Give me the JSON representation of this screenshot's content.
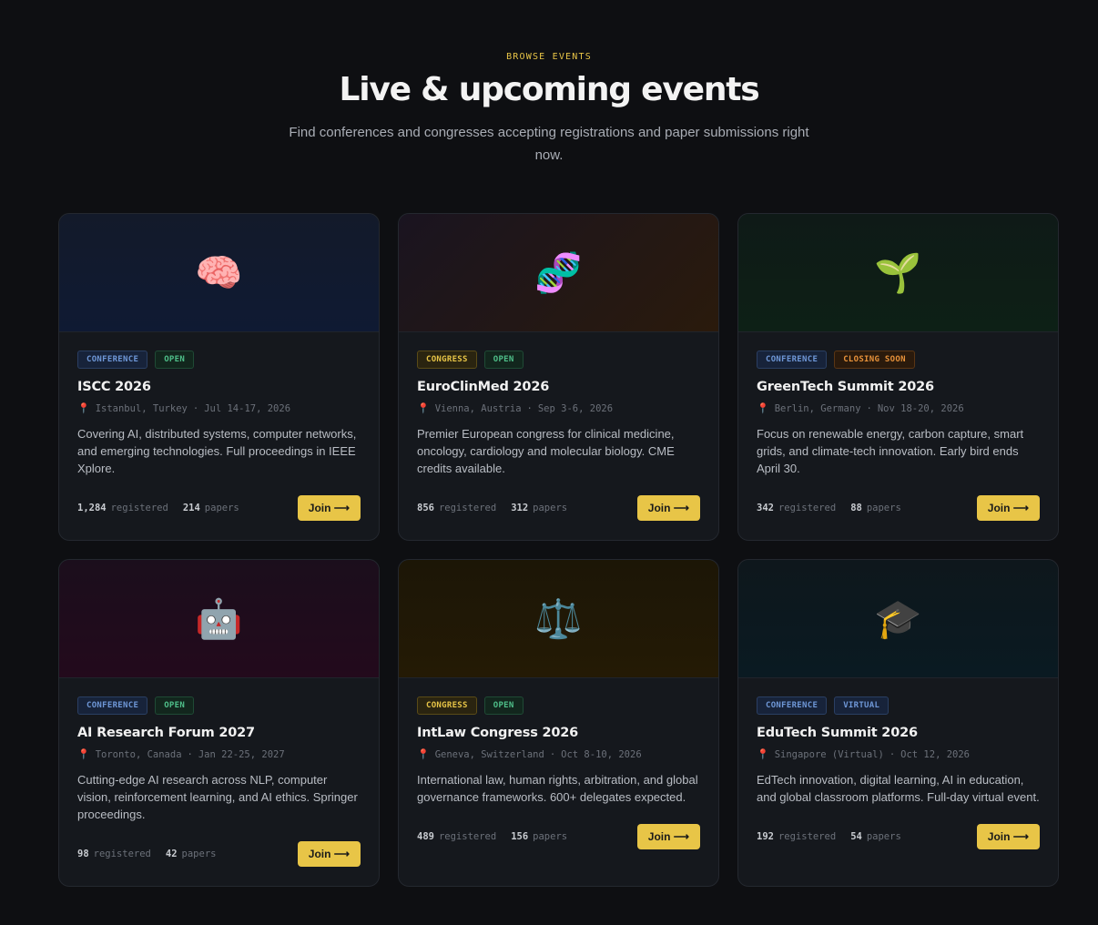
{
  "hero": {
    "eyebrow": "BROWSE EVENTS",
    "title": "Live & upcoming events",
    "subtitle": "Find conferences and congresses accepting registrations and paper submissions right now."
  },
  "events": [
    {
      "icon": "🧠",
      "icon_name": "brain-icon",
      "theme": "b-blue",
      "type": "CONFERENCE",
      "status": "OPEN",
      "title": "ISCC 2026",
      "location": "Istanbul, Turkey",
      "dates": "Jul 14-17, 2026",
      "description": "Covering AI, distributed systems, computer networks, and emerging technologies. Full proceedings in IEEE Xplore.",
      "registered": "1,284",
      "papers": "214",
      "registered_label": "registered",
      "papers_label": "papers",
      "join": "Join ⟶"
    },
    {
      "icon": "🧬",
      "icon_name": "dna-icon",
      "theme": "b-brown",
      "type": "CONGRESS",
      "status": "OPEN",
      "title": "EuroClinMed 2026",
      "location": "Vienna, Austria",
      "dates": "Sep 3-6, 2026",
      "description": "Premier European congress for clinical medicine, oncology, cardiology and molecular biology. CME credits available.",
      "registered": "856",
      "papers": "312",
      "registered_label": "registered",
      "papers_label": "papers",
      "join": "Join ⟶"
    },
    {
      "icon": "🌱",
      "icon_name": "seedling-icon",
      "theme": "b-green",
      "type": "CONFERENCE",
      "status": "CLOSING SOON",
      "title": "GreenTech Summit 2026",
      "location": "Berlin, Germany",
      "dates": "Nov 18-20, 2026",
      "description": "Focus on renewable energy, carbon capture, smart grids, and climate-tech innovation. Early bird ends April 30.",
      "registered": "342",
      "papers": "88",
      "registered_label": "registered",
      "papers_label": "papers",
      "join": "Join ⟶"
    },
    {
      "icon": "🤖",
      "icon_name": "robot-icon",
      "theme": "b-plum",
      "type": "CONFERENCE",
      "status": "OPEN",
      "title": "AI Research Forum 2027",
      "location": "Toronto, Canada",
      "dates": "Jan 22-25, 2027",
      "description": "Cutting-edge AI research across NLP, computer vision, reinforcement learning, and AI ethics. Springer proceedings.",
      "registered": "98",
      "papers": "42",
      "registered_label": "registered",
      "papers_label": "papers",
      "join": "Join ⟶"
    },
    {
      "icon": "⚖️",
      "icon_name": "scales-icon",
      "theme": "b-amber",
      "type": "CONGRESS",
      "status": "OPEN",
      "title": "IntLaw Congress 2026",
      "location": "Geneva, Switzerland",
      "dates": "Oct 8-10, 2026",
      "description": "International law, human rights, arbitration, and global governance frameworks. 600+ delegates expected.",
      "registered": "489",
      "papers": "156",
      "registered_label": "registered",
      "papers_label": "papers",
      "join": "Join ⟶"
    },
    {
      "icon": "🎓",
      "icon_name": "graduation-cap-icon",
      "theme": "b-teal",
      "type": "CONFERENCE",
      "status": "VIRTUAL",
      "title": "EduTech Summit 2026",
      "location": "Singapore (Virtual)",
      "dates": "Oct 12, 2026",
      "description": "EdTech innovation, digital learning, AI in education, and global classroom platforms. Full-day virtual event.",
      "registered": "192",
      "papers": "54",
      "registered_label": "registered",
      "papers_label": "papers",
      "join": "Join ⟶"
    }
  ],
  "colors": {
    "accent": "#e8c547",
    "background": "#0e0f12",
    "card": "#15181d",
    "open": "#4fc08a",
    "closing_soon": "#e8923a",
    "conference": "#6f98d8"
  }
}
